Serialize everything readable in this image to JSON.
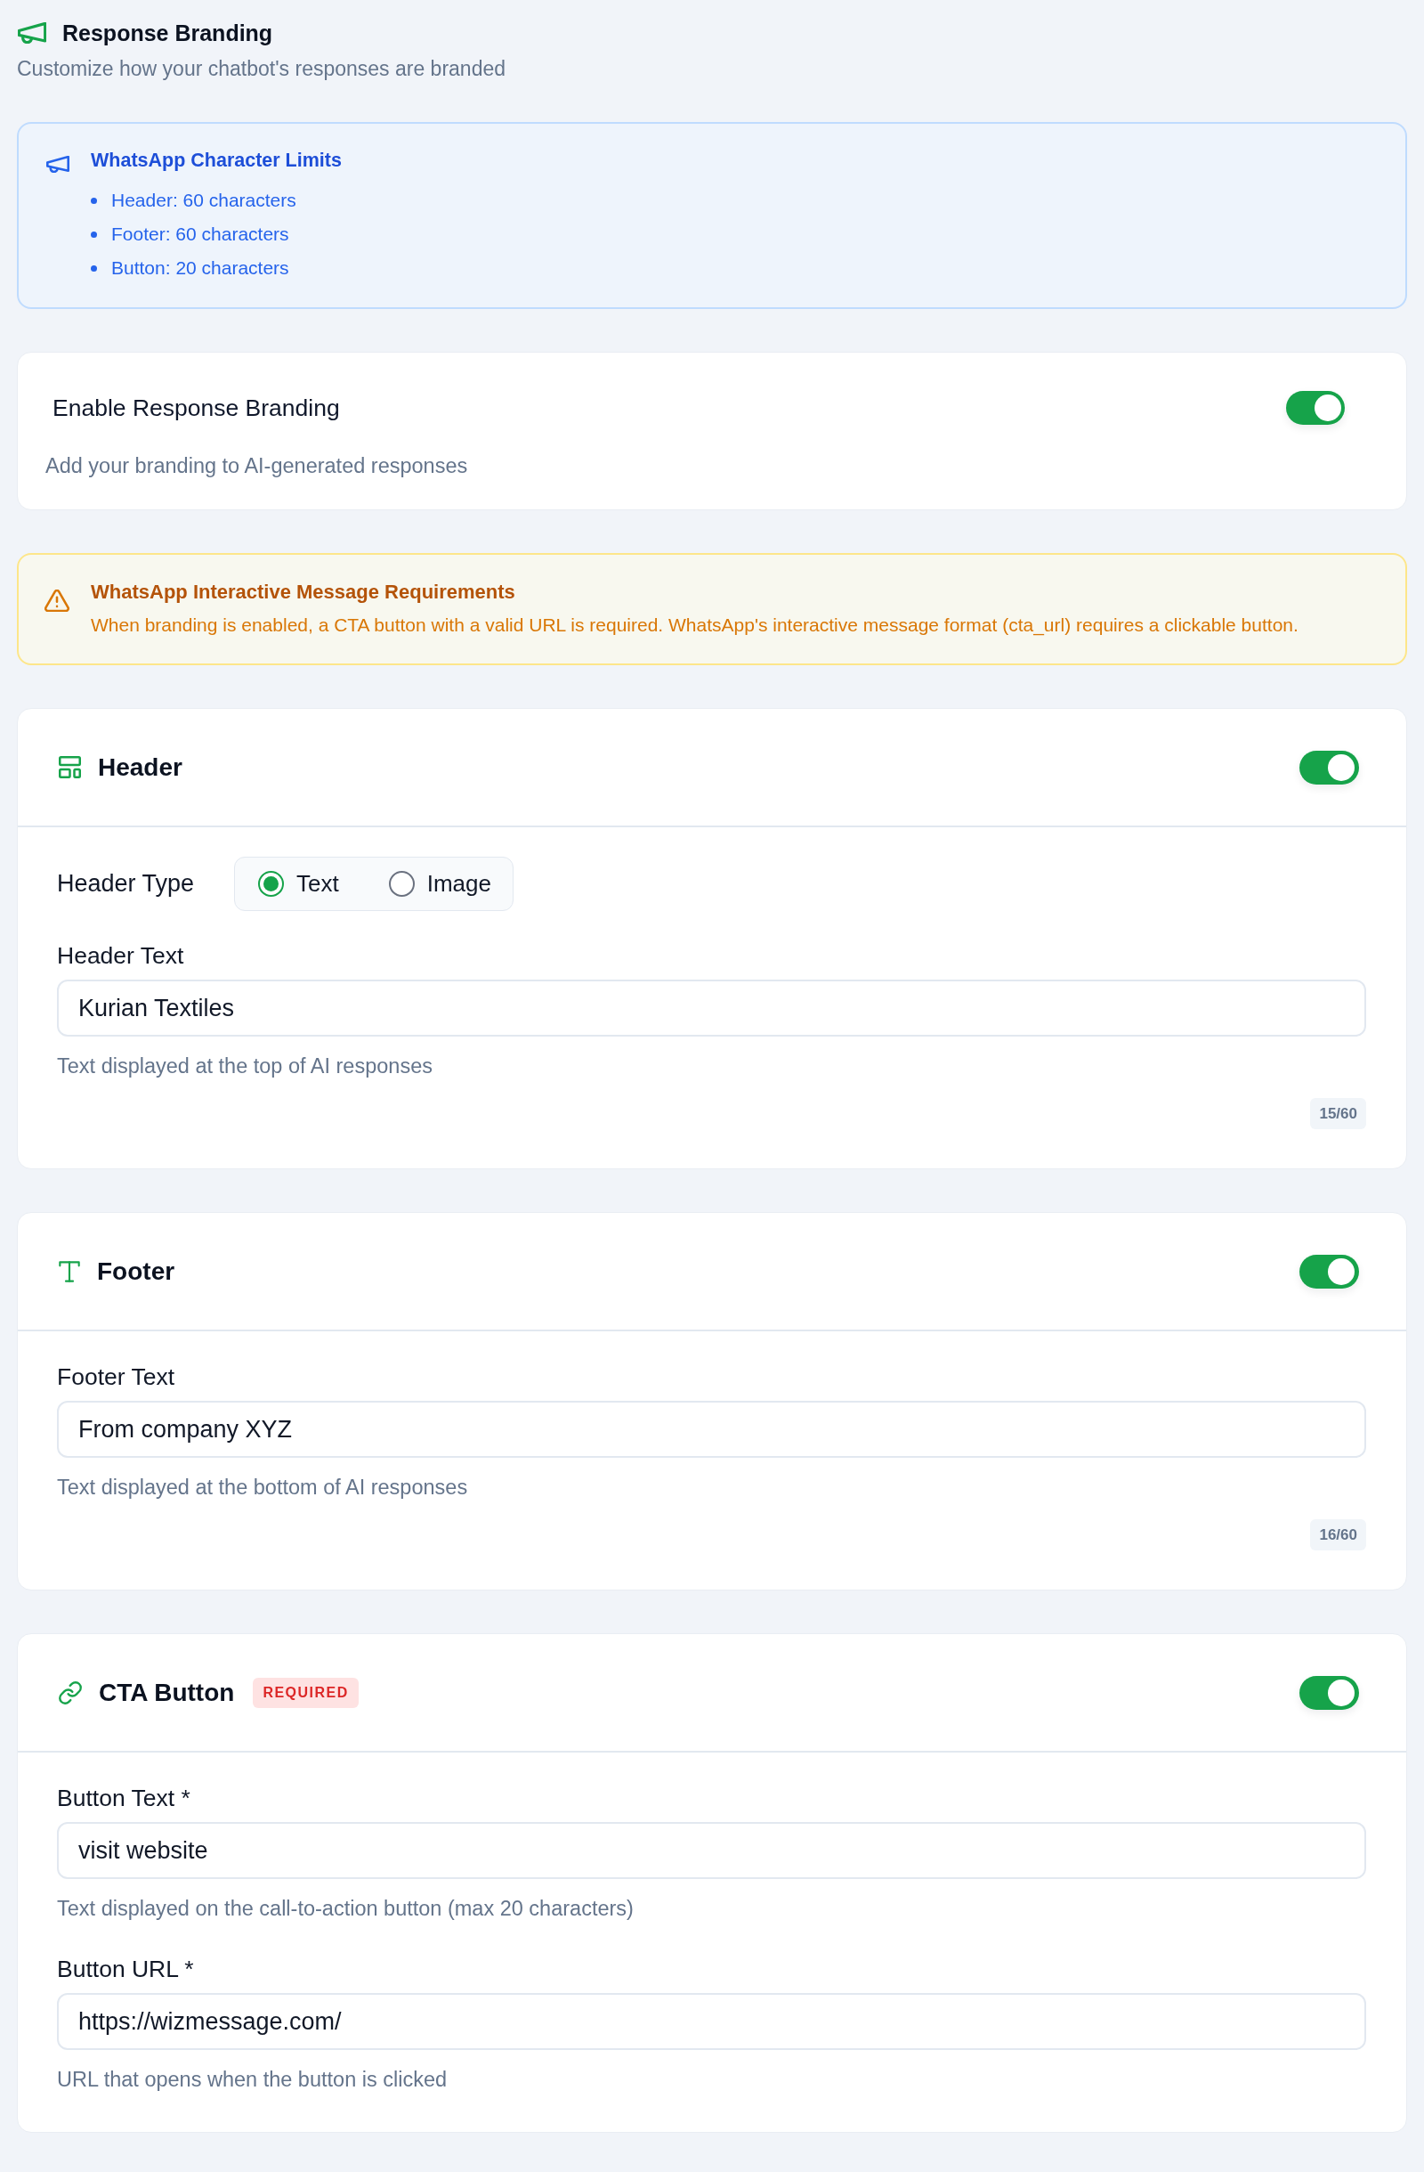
{
  "page": {
    "title": "Response Branding",
    "subtitle": "Customize how your chatbot's responses are branded"
  },
  "limits_notice": {
    "title": "WhatsApp Character Limits",
    "items": [
      "Header: 60 characters",
      "Footer: 60 characters",
      "Button: 20 characters"
    ]
  },
  "enable_card": {
    "title": "Enable Response Branding",
    "description": "Add your branding to AI-generated responses",
    "on": true
  },
  "requirements_notice": {
    "title": "WhatsApp Interactive Message Requirements",
    "text": "When branding is enabled, a CTA button with a valid URL is required. WhatsApp's interactive message format (cta_url) requires a clickable button."
  },
  "sections": [
    {
      "kind": "header",
      "title": "Header",
      "on": true,
      "header_type": {
        "label": "Header Type",
        "options": [
          {
            "label": "Text",
            "selected": true
          },
          {
            "label": "Image",
            "selected": false
          }
        ]
      },
      "fields": [
        {
          "label": "Header Text",
          "value": "Kurian Textiles",
          "hint": "Text displayed at the top of AI responses",
          "counter": "15/60"
        }
      ]
    },
    {
      "kind": "footer",
      "title": "Footer",
      "on": true,
      "fields": [
        {
          "label": "Footer Text",
          "value": "From company XYZ",
          "hint": "Text displayed at the bottom of AI responses",
          "counter": "16/60"
        }
      ]
    },
    {
      "kind": "cta",
      "title": "CTA Button",
      "badge": "REQUIRED",
      "on": true,
      "fields": [
        {
          "label": "Button Text *",
          "value": "visit website",
          "hint": "Text displayed on the call-to-action button (max 20 characters)"
        },
        {
          "label": "Button URL *",
          "value": "https://wizmessage.com/",
          "hint": "URL that opens when the button is clicked"
        }
      ]
    }
  ]
}
